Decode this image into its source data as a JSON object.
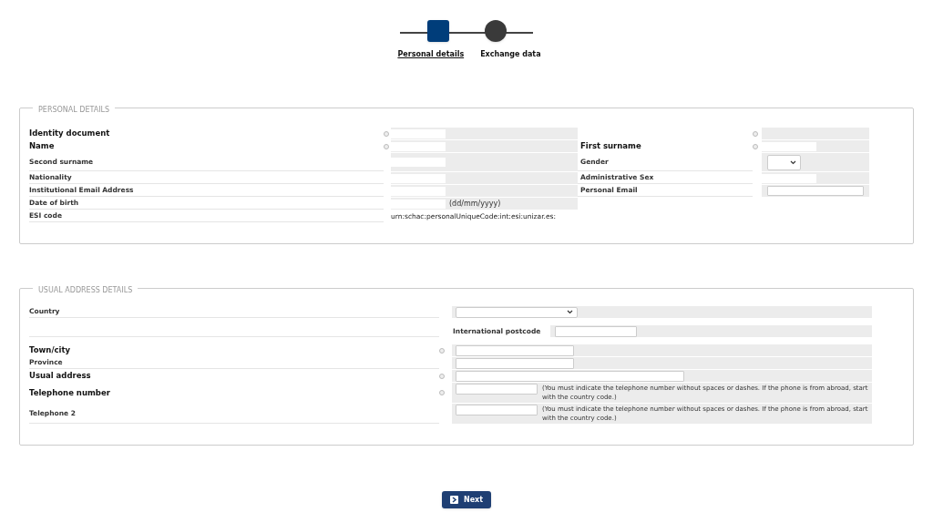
{
  "steps": [
    {
      "label": "Personal details",
      "selected": true
    },
    {
      "label": "Exchange data",
      "selected": false
    }
  ],
  "personal_details": {
    "legend": "PERSONAL DETAILS",
    "rows": [
      {
        "left": {
          "label": "Identity document",
          "required": true,
          "kind": "redacted"
        },
        "right": {
          "required": true,
          "kind": "empty"
        }
      },
      {
        "left": {
          "label": "Name",
          "required": true,
          "kind": "redacted"
        },
        "right": {
          "label": "First surname",
          "required": true,
          "kind": "redacted"
        }
      },
      {
        "left": {
          "label": "Second surname",
          "required": false,
          "kind": "redacted"
        },
        "right": {
          "label": "Gender",
          "required": false,
          "kind": "select"
        }
      },
      {
        "left": {
          "label": "Nationality",
          "required": false,
          "kind": "redacted"
        },
        "right": {
          "label": "Administrative Sex",
          "required": false,
          "kind": "redacted"
        }
      },
      {
        "left": {
          "label": "Institutional Email Address",
          "required": false,
          "kind": "redacted"
        },
        "right": {
          "label": "Personal Email",
          "required": false,
          "kind": "input"
        }
      },
      {
        "left": {
          "label": "Date of birth",
          "required": false,
          "kind": "date",
          "hint": "(dd/mm/yyyy)"
        },
        "right": null
      },
      {
        "left": {
          "label": "ESI code",
          "required": false,
          "kind": "text",
          "value": "urn:schac:personalUniqueCode:int:esi:unizar.es:"
        },
        "right": null
      }
    ]
  },
  "address_details": {
    "legend": "USUAL ADDRESS DETAILS",
    "rows": [
      {
        "label": "Country",
        "required": false,
        "kind": "select"
      },
      {
        "required": false,
        "kind": "postcode",
        "sublabel": "International postcode"
      },
      {
        "label": "Town/city",
        "required": true,
        "kind": "input"
      },
      {
        "label": "Province",
        "required": false,
        "kind": "input"
      },
      {
        "label": "Usual address",
        "required": true,
        "kind": "wide_input"
      },
      {
        "label": "Telephone number",
        "required": true,
        "kind": "phone",
        "hint": "(You must indicate the telephone number without spaces or dashes. If the phone is from abroad, start with the country code.)"
      },
      {
        "label": "Telephone 2",
        "required": false,
        "kind": "phone",
        "hint": "(You must indicate the telephone number without spaces or dashes. If the phone is from abroad, start with the country code.)"
      }
    ]
  },
  "next_button": "Next"
}
